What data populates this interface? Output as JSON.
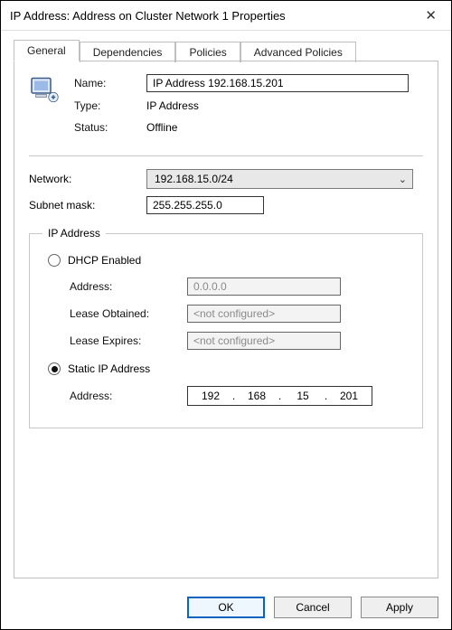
{
  "window": {
    "title": "IP Address: Address on Cluster Network 1 Properties",
    "close_glyph": "✕"
  },
  "tabs": {
    "items": [
      {
        "label": "General",
        "active": true
      },
      {
        "label": "Dependencies",
        "active": false
      },
      {
        "label": "Policies",
        "active": false
      },
      {
        "label": "Advanced Policies",
        "active": false
      }
    ]
  },
  "general": {
    "name_label": "Name:",
    "name_value": "IP Address 192.168.15.201",
    "type_label": "Type:",
    "type_value": "IP Address",
    "status_label": "Status:",
    "status_value": "Offline"
  },
  "network": {
    "label": "Network:",
    "selected": "192.168.15.0/24",
    "subnet_label": "Subnet mask:",
    "subnet_value": "255.255.255.0"
  },
  "ip_group": {
    "legend": "IP Address",
    "dhcp_label": "DHCP Enabled",
    "dhcp": {
      "address_label": "Address:",
      "address_value": "0.0.0.0",
      "lease_obtained_label": "Lease Obtained:",
      "lease_obtained_value": "<not configured>",
      "lease_expires_label": "Lease Expires:",
      "lease_expires_value": "<not configured>"
    },
    "static_label": "Static IP Address",
    "static": {
      "address_label": "Address:",
      "oct1": "192",
      "oct2": "168",
      "oct3": "15",
      "oct4": "201"
    }
  },
  "buttons": {
    "ok": "OK",
    "cancel": "Cancel",
    "apply": "Apply"
  }
}
